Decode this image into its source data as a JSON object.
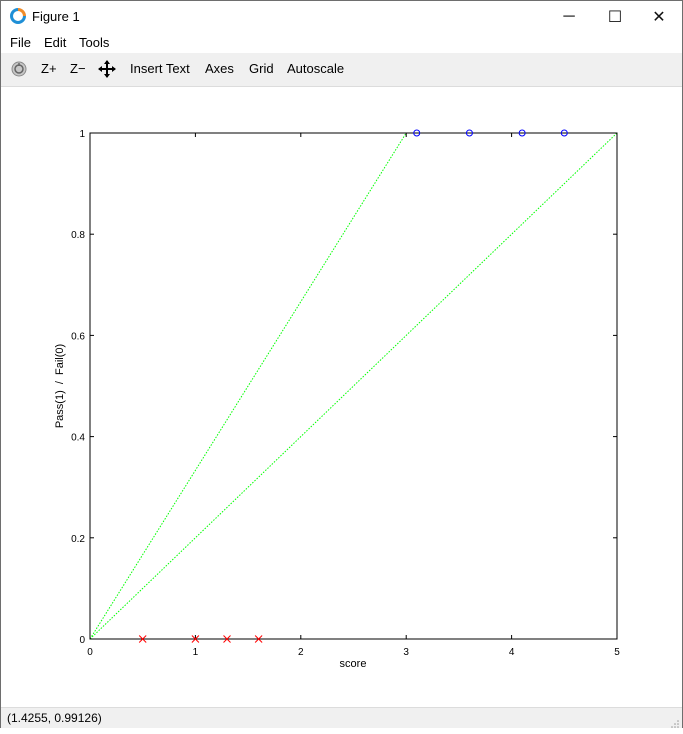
{
  "window": {
    "title": "Figure 1",
    "controls": {
      "minimize": "─",
      "maximize": "☐",
      "close": "✕"
    }
  },
  "menu": {
    "items": [
      "File",
      "Edit",
      "Tools"
    ]
  },
  "toolbar": {
    "zoom_in": "Z+",
    "zoom_out": "Z−",
    "insert_text": "Insert Text",
    "axes": "Axes",
    "grid": "Grid",
    "autoscale": "Autoscale"
  },
  "status": {
    "coordinates": "(1.4255, 0.99126)"
  },
  "colors": {
    "pass": "#0000ff",
    "fail": "#ff0000",
    "boundary": "#00ff00"
  },
  "chart_data": {
    "type": "scatter",
    "xlabel": "score",
    "ylabel": "Pass(1)  /  Fail(0)",
    "xlim": [
      0,
      5
    ],
    "ylim": [
      0,
      1
    ],
    "xticks": [
      "0",
      "1",
      "2",
      "3",
      "4",
      "5"
    ],
    "yticks": [
      "0",
      "0.2",
      "0.4",
      "0.6",
      "0.8",
      "1"
    ],
    "grid": false,
    "series": [
      {
        "marker": "circle",
        "color": "#0000ff",
        "x": [
          3.1,
          3.6,
          4.1,
          4.5
        ],
        "y": [
          1,
          1,
          1,
          1
        ]
      },
      {
        "marker": "x",
        "color": "#ff0000",
        "x": [
          0.5,
          1.0,
          1.3,
          1.6
        ],
        "y": [
          0,
          0,
          0,
          0
        ]
      },
      {
        "marker": "dotted-line",
        "color": "#00ff00",
        "x": [
          0,
          3
        ],
        "y": [
          0,
          1
        ]
      },
      {
        "marker": "dotted-line",
        "color": "#00ff00",
        "x": [
          0,
          5
        ],
        "y": [
          0,
          1
        ]
      }
    ]
  }
}
